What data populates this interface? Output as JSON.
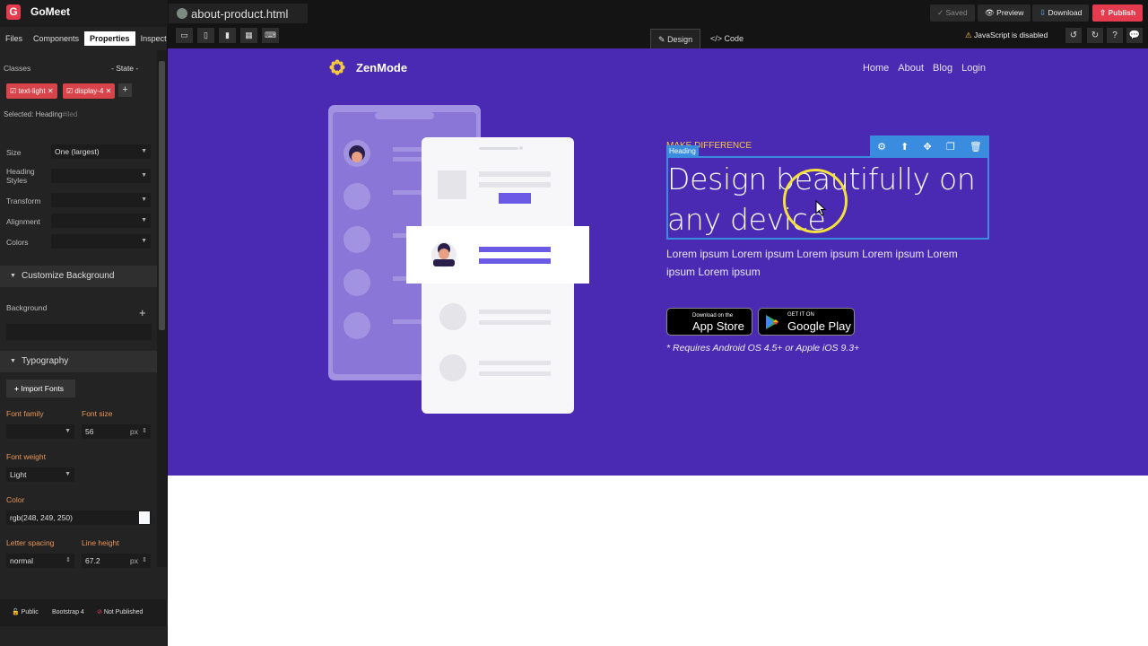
{
  "app": {
    "name": "GoMeet",
    "logo_letter": "G"
  },
  "left_tabs": [
    "Files",
    "Components",
    "Properties",
    "Inspect"
  ],
  "classes": {
    "label": "Classes",
    "state": "- State -",
    "chips": [
      "text-light",
      "display-4"
    ]
  },
  "selected": {
    "prefix": "Selected:",
    "name": "Heading",
    "suffix": "#iled"
  },
  "props": {
    "size_label": "Size",
    "size_value": "One (largest)",
    "heading_styles_label_1": "Heading",
    "heading_styles_label_2": "Styles",
    "transform_label": "Transform",
    "alignment_label": "Alignment",
    "colors_label": "Colors"
  },
  "background_section": {
    "title": "Customize Background",
    "label": "Background",
    "add": "+"
  },
  "typography": {
    "title": "Typography",
    "import_label": "Import Fonts",
    "font_family_label": "Font family",
    "font_size_label": "Font size",
    "font_size_value": "56",
    "font_size_unit": "px",
    "font_weight_label": "Font weight",
    "font_weight_value": "Light",
    "color_label": "Color",
    "color_value": "rgb(248, 249, 250)",
    "letter_spacing_label": "Letter spacing",
    "letter_spacing_value": "normal",
    "line_height_label": "Line height",
    "line_height_value": "67.2",
    "line_height_unit": "px"
  },
  "footer_badges": [
    "Public",
    "Bootstrap 4",
    "Not Published"
  ],
  "file_tab": "about-product.html",
  "top_buttons": {
    "saved": "Saved",
    "preview": "Preview",
    "download": "Download",
    "publish": "Publish"
  },
  "modes": {
    "design": "Design",
    "code": "Code"
  },
  "js_warning": "JavaScript is disabled",
  "site": {
    "brand": "ZenMode",
    "nav": [
      "Home",
      "About",
      "Blog",
      "Login"
    ],
    "eyebrow": "MAKE DIFFERENCE",
    "heading_tag": "Heading",
    "heading": "Design beautifully on any device",
    "lead": "Lorem ipsum Lorem ipsum Lorem ipsum Lorem ipsum Lorem ipsum Lorem ipsum",
    "app_store_small": "Download on the",
    "app_store_large": "App Store",
    "google_small": "GET IT ON",
    "google_large": "Google Play",
    "note": "* Requires Android OS 4.5+ or Apple iOS 9.3+"
  },
  "colors": {
    "accent": "#3a8cdf",
    "hero": "#4a2ab2",
    "publish": "#e53b4f",
    "chip": "#d9434a"
  }
}
